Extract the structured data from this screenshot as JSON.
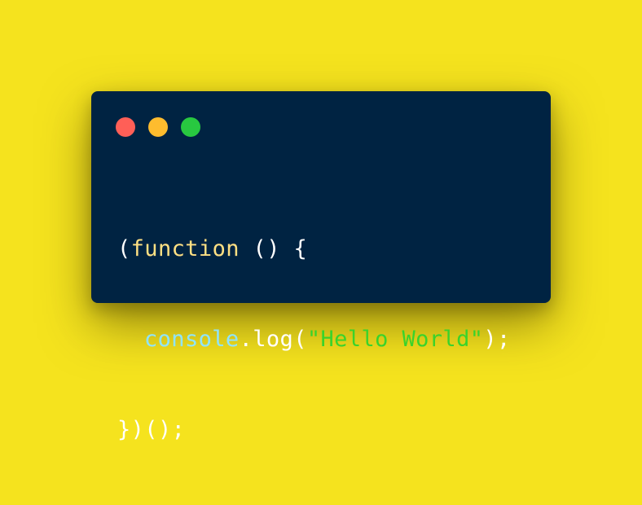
{
  "colors": {
    "background": "#F5E31E",
    "window_bg": "#002342",
    "close": "#FF5F57",
    "minimize": "#FEBC2E",
    "maximize": "#28C840",
    "punctuation": "#FFFFFF",
    "keyword": "#FFE083",
    "identifier": "#8FE4FF",
    "string": "#39D32B"
  },
  "window_controls": [
    "close-dot",
    "minimize-dot",
    "maximize-dot"
  ],
  "code": {
    "line1": {
      "open_paren": "(",
      "keyword": "function",
      "rest": " () {"
    },
    "line2": {
      "object": "console",
      "dot": ".",
      "method": "log",
      "open_paren": "(",
      "string": "\"Hello World\"",
      "close": ");"
    },
    "line3": {
      "text": "})();"
    }
  }
}
